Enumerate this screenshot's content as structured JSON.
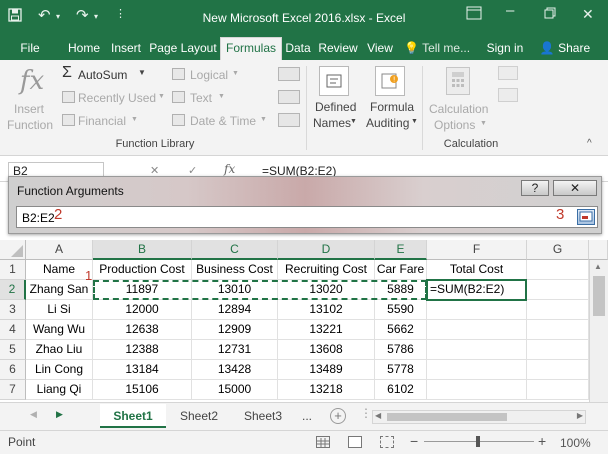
{
  "window": {
    "title": "New Microsoft Excel 2016.xlsx - Excel",
    "quick_access_icons": [
      "save-icon",
      "undo-icon",
      "redo-icon",
      "customize-qat-icon"
    ],
    "controls_icons": [
      "ribbon-display-options-icon",
      "minimize-icon",
      "restore-icon",
      "close-icon"
    ]
  },
  "tabs": {
    "file": "File",
    "home": "Home",
    "insert": "Insert",
    "page_layout": "Page Layout",
    "formulas": "Formulas",
    "data": "Data",
    "review": "Review",
    "view": "View",
    "tell_me": "Tell me...",
    "sign_in": "Sign in",
    "share": "Share"
  },
  "ribbon": {
    "insert_function": [
      "Insert",
      "Function"
    ],
    "autosum": "AutoSum",
    "recently_used": "Recently Used",
    "financial": "Financial",
    "logical": "Logical",
    "text": "Text",
    "date_time": "Date & Time",
    "defined_names": [
      "Defined",
      "Names"
    ],
    "formula_auditing": [
      "Formula",
      "Auditing"
    ],
    "calculation_options": [
      "Calculation",
      "Options"
    ],
    "group_function_library": "Function Library",
    "group_calculation": "Calculation"
  },
  "formula_bar": {
    "name_box": "B2",
    "formula": "=SUM(B2:E2)"
  },
  "dialog": {
    "title": "Function Arguments",
    "help": "?",
    "close": "✕",
    "value": "B2:E2",
    "marker_1": "1",
    "marker_2": "2",
    "marker_3": "3"
  },
  "sheet": {
    "columns": [
      "A",
      "B",
      "C",
      "D",
      "E",
      "F",
      "G"
    ],
    "rows": [
      {
        "num": "1",
        "cells": [
          "Name",
          "Production Cost",
          "Business Cost",
          "Recruiting Cost",
          "Car Fare",
          "Total Cost",
          ""
        ]
      },
      {
        "num": "2",
        "cells": [
          "Zhang San",
          "11897",
          "13010",
          "13020",
          "5889",
          "=SUM(B2:E2)",
          ""
        ]
      },
      {
        "num": "3",
        "cells": [
          "Li Si",
          "12000",
          "12894",
          "13102",
          "5590",
          "",
          ""
        ]
      },
      {
        "num": "4",
        "cells": [
          "Wang Wu",
          "12638",
          "12909",
          "13221",
          "5662",
          "",
          ""
        ]
      },
      {
        "num": "5",
        "cells": [
          "Zhao Liu",
          "12388",
          "12731",
          "13608",
          "5786",
          "",
          ""
        ]
      },
      {
        "num": "6",
        "cells": [
          "Lin Cong",
          "13184",
          "13428",
          "13489",
          "5778",
          "",
          ""
        ]
      },
      {
        "num": "7",
        "cells": [
          "Liang Qi",
          "15106",
          "15000",
          "13218",
          "6102",
          "",
          ""
        ]
      }
    ]
  },
  "sheet_tabs": {
    "tabs": [
      "Sheet1",
      "Sheet2",
      "Sheet3"
    ],
    "more": "...",
    "add": "+"
  },
  "status": {
    "mode": "Point",
    "zoom": "100%",
    "zoom_minus": "−",
    "zoom_plus": "+"
  },
  "colors": {
    "accent": "#217346",
    "marker": "#c0392b"
  }
}
